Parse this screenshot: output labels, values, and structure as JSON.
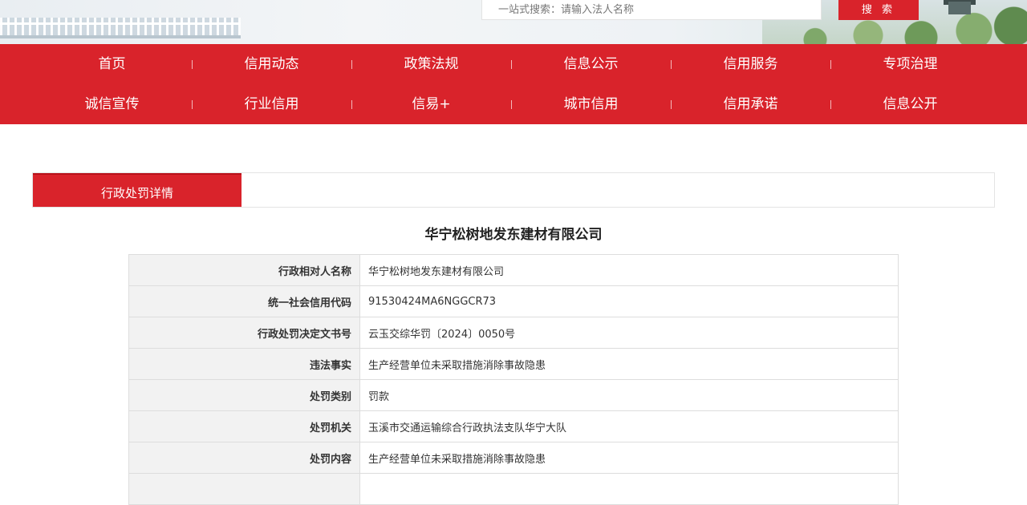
{
  "search": {
    "placeholder": "一站式搜索：请输入法人名称",
    "button_label": "搜 索"
  },
  "nav": {
    "row1": [
      "首页",
      "信用动态",
      "政策法规",
      "信息公示",
      "信用服务",
      "专项治理"
    ],
    "row2": [
      "诚信宣传",
      "行业信用",
      "信易+",
      "城市信用",
      "信用承诺",
      "信息公开"
    ]
  },
  "tab": {
    "label": "行政处罚详情"
  },
  "company_title": "华宁松树地发东建材有限公司",
  "details": [
    {
      "label": "行政相对人名称",
      "value": "华宁松树地发东建材有限公司"
    },
    {
      "label": "统一社会信用代码",
      "value": "91530424MA6NGGCR73"
    },
    {
      "label": "行政处罚决定文书号",
      "value": "云玉交综华罚〔2024〕0050号"
    },
    {
      "label": "违法事实",
      "value": "生产经营单位未采取措施消除事故隐患"
    },
    {
      "label": "处罚类别",
      "value": "罚款"
    },
    {
      "label": "处罚机关",
      "value": "玉溪市交通运输综合行政执法支队华宁大队"
    },
    {
      "label": "处罚内容",
      "value": "生产经营单位未采取措施消除事故隐患"
    },
    {
      "label": "",
      "value": ""
    }
  ],
  "colors": {
    "brand_red": "#d9232b",
    "label_bg": "#f2f2f2"
  }
}
